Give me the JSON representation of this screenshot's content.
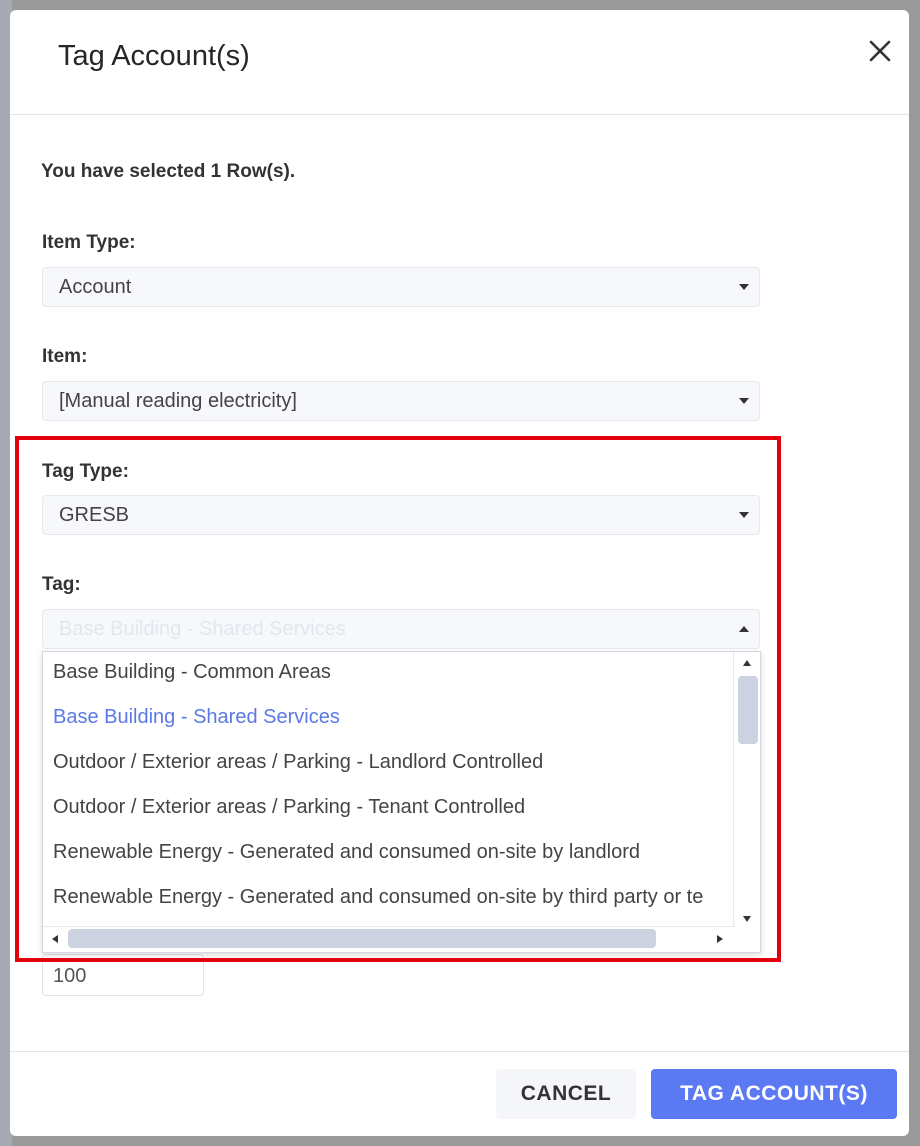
{
  "modal": {
    "title": "Tag Account(s)",
    "selected_info": "You have selected 1 Row(s)."
  },
  "fields": {
    "item_type": {
      "label": "Item Type:",
      "value": "Account"
    },
    "item": {
      "label": "Item:",
      "value": "[Manual reading electricity]"
    },
    "tag_type": {
      "label": "Tag Type:",
      "value": "GRESB"
    },
    "tag": {
      "label": "Tag:",
      "value": "Base Building - Shared Services",
      "options": [
        "Base Building - Common Areas",
        "Base Building - Shared Services",
        "Outdoor / Exterior areas / Parking - Landlord Controlled",
        "Outdoor / Exterior areas / Parking - Tenant Controlled",
        "Renewable Energy - Generated and consumed on-site by landlord",
        "Renewable Energy - Generated and consumed on-site by third party or te"
      ],
      "selected_index": 1
    },
    "percentage": {
      "value": "100"
    }
  },
  "footer": {
    "cancel_label": "CANCEL",
    "submit_label": "TAG ACCOUNT(S)"
  },
  "colors": {
    "primary": "#5b79f3",
    "highlight_border": "#e3000f",
    "active_option": "#5b79e6"
  }
}
